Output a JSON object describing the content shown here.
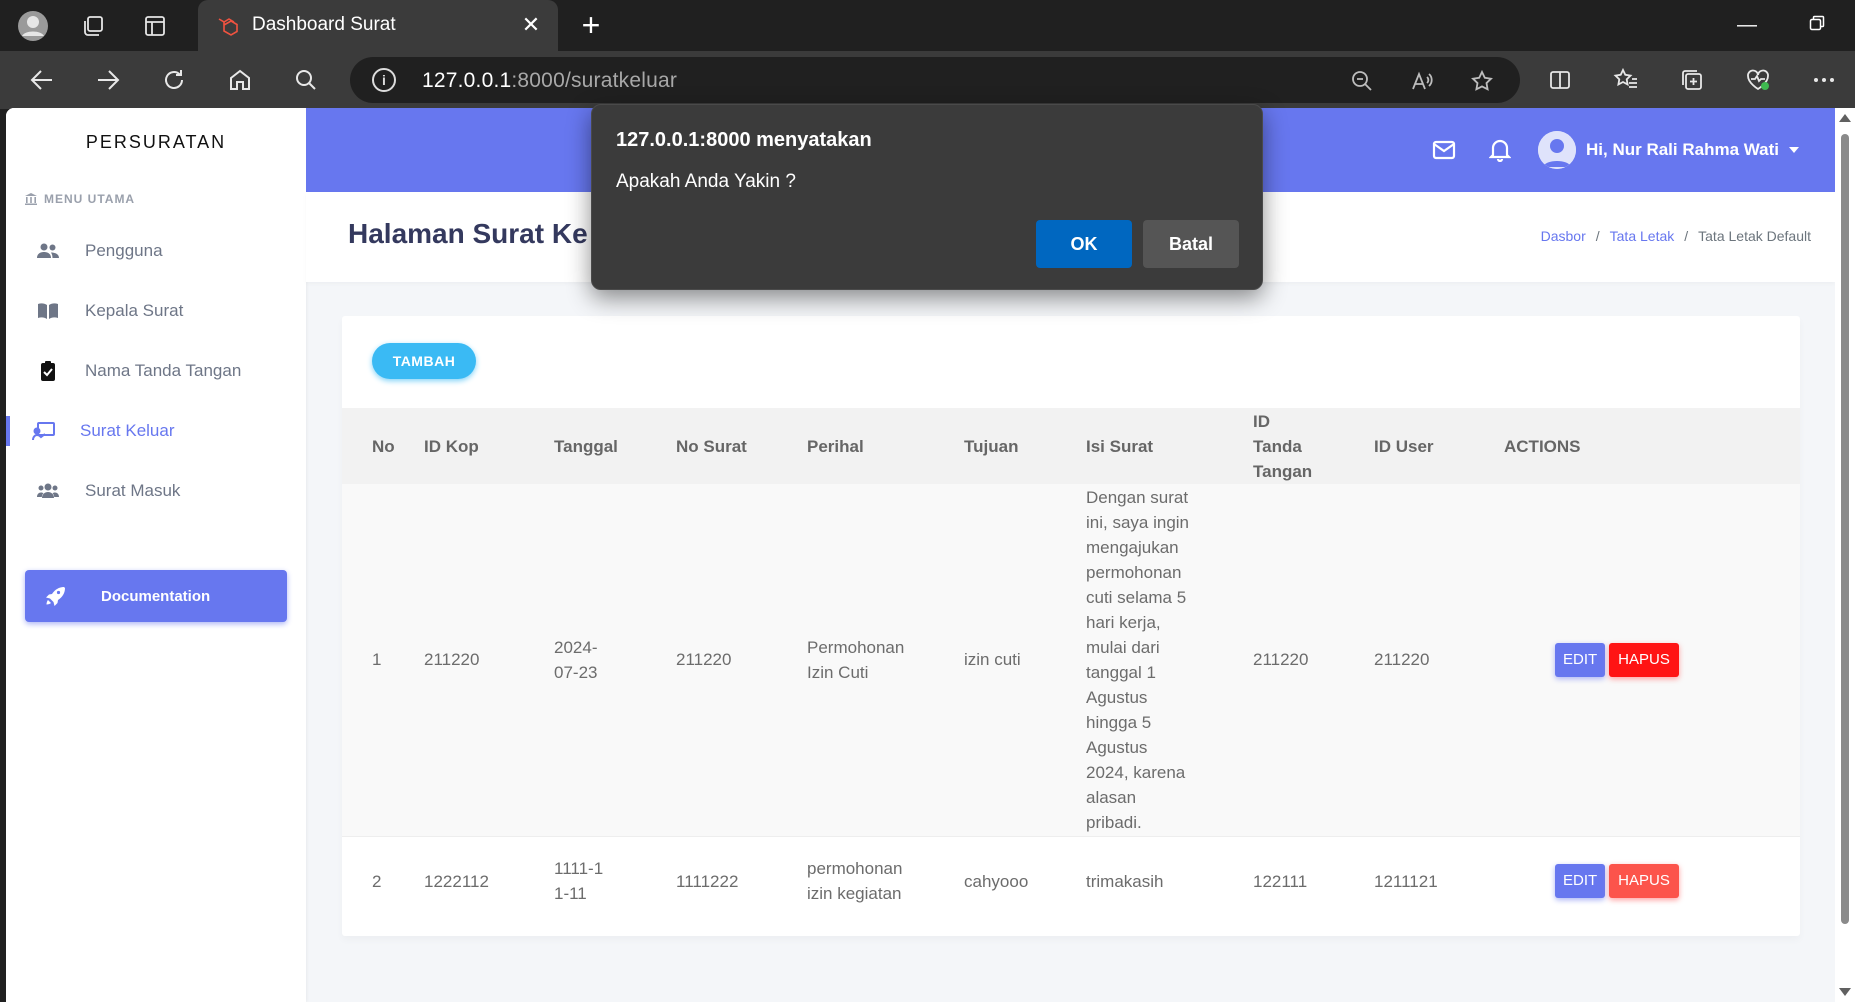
{
  "browser": {
    "tab_title": "Dashboard Surat",
    "url_host": "127.0.0.1",
    "url_path": ":8000/suratkeluar",
    "icons": [
      "profile-icon",
      "workspaces-icon",
      "tab-actions-icon",
      "laravel-favicon",
      "close-icon",
      "new-tab-icon",
      "minimize-icon",
      "restore-icon",
      "back-icon",
      "forward-icon",
      "refresh-icon",
      "home-icon",
      "search-icon",
      "info-icon",
      "zoom-out-icon",
      "read-aloud-icon",
      "favorite-icon",
      "split-screen-icon",
      "favorites-icon",
      "collections-icon",
      "browser-essentials-icon",
      "more-icon"
    ]
  },
  "sidebar": {
    "brand": "PERSURATAN",
    "menu_header": "MENU UTAMA",
    "items": [
      {
        "label": "Pengguna",
        "icon": "users-icon"
      },
      {
        "label": "Kepala Surat",
        "icon": "book-icon"
      },
      {
        "label": "Nama Tanda Tangan",
        "icon": "clipboard-check-icon"
      },
      {
        "label": "Surat Keluar",
        "icon": "chalkboard-teacher-icon",
        "active": true
      },
      {
        "label": "Surat Masuk",
        "icon": "users-group-icon"
      }
    ],
    "doc_button": "Documentation"
  },
  "topbar": {
    "user_name": "Hi, Nur Rali Rahma Wati",
    "accent": "#6777ef"
  },
  "section": {
    "title": "Halaman Surat Ke",
    "breadcrumb": [
      "Dasbor",
      "Tata Letak",
      "Tata Letak Default"
    ]
  },
  "card": {
    "add_button": "TAMBAH",
    "columns": [
      "No",
      "ID Kop",
      "Tanggal",
      "No Surat",
      "Perihal",
      "Tujuan",
      "Isi Surat",
      "ID Tanda Tangan",
      "ID User",
      "ACTIONS"
    ],
    "rows": [
      {
        "no": "1",
        "id_kop": "211220",
        "tanggal": "2024-07-23",
        "no_surat": "211220",
        "perihal": "Permohonan Izin Cuti",
        "tujuan": "izin cuti",
        "isi_surat": "Dengan surat ini, saya ingin mengajukan permohonan cuti selama 5 hari kerja, mulai dari tanggal 1 Agustus hingga 5 Agustus 2024, karena alasan pribadi.",
        "id_ttd": "211220",
        "id_user": "211220"
      },
      {
        "no": "2",
        "id_kop": "1222112",
        "tanggal": "1111-11-11",
        "no_surat": "1111222",
        "perihal": "permohonan izin kegiatan",
        "tujuan": "cahyooo",
        "isi_surat": "trimakasih",
        "id_ttd": "122111",
        "id_user": "1211121"
      }
    ],
    "edit_label": "EDIT",
    "delete_label": "HAPUS"
  },
  "dialog": {
    "title": "127.0.0.1:8000 menyatakan",
    "message": "Apakah Anda Yakin ?",
    "ok": "OK",
    "cancel": "Batal"
  }
}
